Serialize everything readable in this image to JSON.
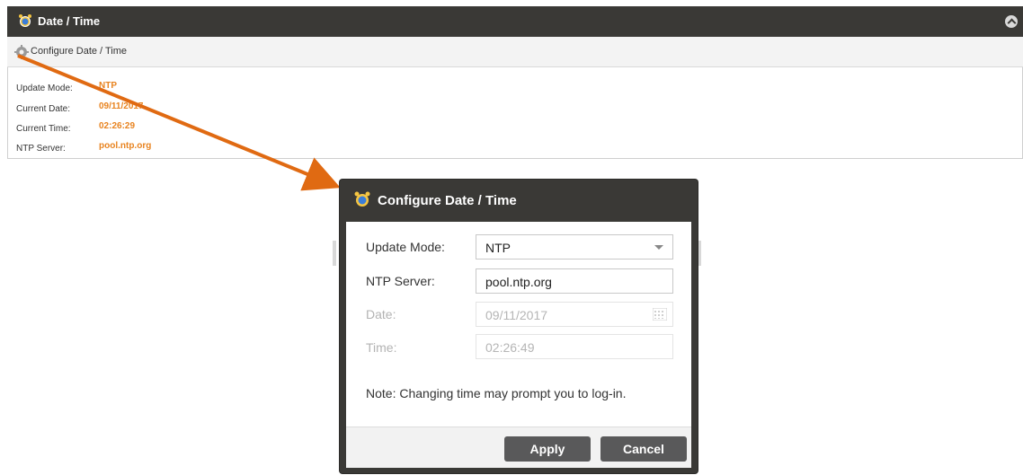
{
  "panel": {
    "title": "Date / Time",
    "toolbar_label": "Configure Date / Time",
    "rows": [
      {
        "label": "Update Mode:",
        "value": "NTP"
      },
      {
        "label": "Current Date:",
        "value": "09/11/2017"
      },
      {
        "label": "Current Time:",
        "value": "02:26:29"
      },
      {
        "label": "NTP Server:",
        "value": "pool.ntp.org"
      }
    ]
  },
  "dialog": {
    "title": "Configure Date / Time",
    "fields": {
      "update_mode": {
        "label": "Update Mode:",
        "value": "NTP"
      },
      "ntp_server": {
        "label": "NTP Server:",
        "value": "pool.ntp.org"
      },
      "date": {
        "label": "Date:",
        "value": "09/11/2017"
      },
      "time": {
        "label": "Time:",
        "value": "02:26:49"
      }
    },
    "note": "Note: Changing time may prompt you to log-in.",
    "buttons": {
      "apply": "Apply",
      "cancel": "Cancel"
    }
  },
  "colors": {
    "header_bg": "#3a3936",
    "accent": "#e8831f",
    "button_bg": "#59595a"
  },
  "icons": {
    "header": "alarm-clock-icon",
    "toolbar": "gear-icon",
    "collapse": "chevron-up-icon",
    "date_picker": "calendar-icon"
  }
}
